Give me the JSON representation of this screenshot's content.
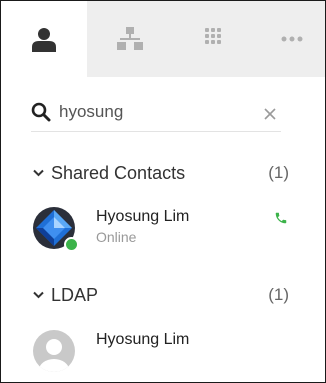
{
  "tabs": [
    {
      "icon": "person-icon",
      "active": true
    },
    {
      "icon": "org-chart-icon",
      "active": false
    },
    {
      "icon": "apps-grid-icon",
      "active": false
    },
    {
      "icon": "more-dots-icon",
      "active": false
    }
  ],
  "search": {
    "value": "hyosung",
    "clear_icon": "close-icon"
  },
  "groups": [
    {
      "name": "Shared Contacts",
      "count": "(1)",
      "contacts": [
        {
          "name": "Hyosung Lim",
          "status": "Online",
          "avatar": "blue-diamond-avatar",
          "action_icon": "phone-icon"
        }
      ]
    },
    {
      "name": "LDAP",
      "count": "(1)",
      "contacts": [
        {
          "name": "Hyosung Lim",
          "avatar": "default-user-avatar"
        }
      ]
    }
  ],
  "colors": {
    "online": "#3cb34a",
    "tab_bar": "#eeeeee",
    "icon_active": "#333333",
    "icon_inactive": "#b0b0b0"
  }
}
